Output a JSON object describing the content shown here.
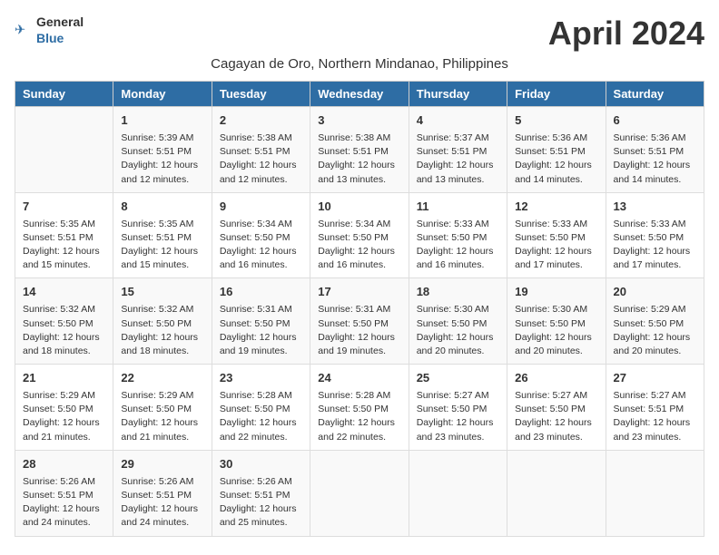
{
  "header": {
    "title": "April 2024",
    "subtitle": "Cagayan de Oro, Northern Mindanao, Philippines",
    "logo_general": "General",
    "logo_blue": "Blue"
  },
  "columns": [
    "Sunday",
    "Monday",
    "Tuesday",
    "Wednesday",
    "Thursday",
    "Friday",
    "Saturday"
  ],
  "weeks": [
    [
      {
        "day": "",
        "info": ""
      },
      {
        "day": "1",
        "info": "Sunrise: 5:39 AM\nSunset: 5:51 PM\nDaylight: 12 hours\nand 12 minutes."
      },
      {
        "day": "2",
        "info": "Sunrise: 5:38 AM\nSunset: 5:51 PM\nDaylight: 12 hours\nand 12 minutes."
      },
      {
        "day": "3",
        "info": "Sunrise: 5:38 AM\nSunset: 5:51 PM\nDaylight: 12 hours\nand 13 minutes."
      },
      {
        "day": "4",
        "info": "Sunrise: 5:37 AM\nSunset: 5:51 PM\nDaylight: 12 hours\nand 13 minutes."
      },
      {
        "day": "5",
        "info": "Sunrise: 5:36 AM\nSunset: 5:51 PM\nDaylight: 12 hours\nand 14 minutes."
      },
      {
        "day": "6",
        "info": "Sunrise: 5:36 AM\nSunset: 5:51 PM\nDaylight: 12 hours\nand 14 minutes."
      }
    ],
    [
      {
        "day": "7",
        "info": "Sunrise: 5:35 AM\nSunset: 5:51 PM\nDaylight: 12 hours\nand 15 minutes."
      },
      {
        "day": "8",
        "info": "Sunrise: 5:35 AM\nSunset: 5:51 PM\nDaylight: 12 hours\nand 15 minutes."
      },
      {
        "day": "9",
        "info": "Sunrise: 5:34 AM\nSunset: 5:50 PM\nDaylight: 12 hours\nand 16 minutes."
      },
      {
        "day": "10",
        "info": "Sunrise: 5:34 AM\nSunset: 5:50 PM\nDaylight: 12 hours\nand 16 minutes."
      },
      {
        "day": "11",
        "info": "Sunrise: 5:33 AM\nSunset: 5:50 PM\nDaylight: 12 hours\nand 16 minutes."
      },
      {
        "day": "12",
        "info": "Sunrise: 5:33 AM\nSunset: 5:50 PM\nDaylight: 12 hours\nand 17 minutes."
      },
      {
        "day": "13",
        "info": "Sunrise: 5:33 AM\nSunset: 5:50 PM\nDaylight: 12 hours\nand 17 minutes."
      }
    ],
    [
      {
        "day": "14",
        "info": "Sunrise: 5:32 AM\nSunset: 5:50 PM\nDaylight: 12 hours\nand 18 minutes."
      },
      {
        "day": "15",
        "info": "Sunrise: 5:32 AM\nSunset: 5:50 PM\nDaylight: 12 hours\nand 18 minutes."
      },
      {
        "day": "16",
        "info": "Sunrise: 5:31 AM\nSunset: 5:50 PM\nDaylight: 12 hours\nand 19 minutes."
      },
      {
        "day": "17",
        "info": "Sunrise: 5:31 AM\nSunset: 5:50 PM\nDaylight: 12 hours\nand 19 minutes."
      },
      {
        "day": "18",
        "info": "Sunrise: 5:30 AM\nSunset: 5:50 PM\nDaylight: 12 hours\nand 20 minutes."
      },
      {
        "day": "19",
        "info": "Sunrise: 5:30 AM\nSunset: 5:50 PM\nDaylight: 12 hours\nand 20 minutes."
      },
      {
        "day": "20",
        "info": "Sunrise: 5:29 AM\nSunset: 5:50 PM\nDaylight: 12 hours\nand 20 minutes."
      }
    ],
    [
      {
        "day": "21",
        "info": "Sunrise: 5:29 AM\nSunset: 5:50 PM\nDaylight: 12 hours\nand 21 minutes."
      },
      {
        "day": "22",
        "info": "Sunrise: 5:29 AM\nSunset: 5:50 PM\nDaylight: 12 hours\nand 21 minutes."
      },
      {
        "day": "23",
        "info": "Sunrise: 5:28 AM\nSunset: 5:50 PM\nDaylight: 12 hours\nand 22 minutes."
      },
      {
        "day": "24",
        "info": "Sunrise: 5:28 AM\nSunset: 5:50 PM\nDaylight: 12 hours\nand 22 minutes."
      },
      {
        "day": "25",
        "info": "Sunrise: 5:27 AM\nSunset: 5:50 PM\nDaylight: 12 hours\nand 23 minutes."
      },
      {
        "day": "26",
        "info": "Sunrise: 5:27 AM\nSunset: 5:50 PM\nDaylight: 12 hours\nand 23 minutes."
      },
      {
        "day": "27",
        "info": "Sunrise: 5:27 AM\nSunset: 5:51 PM\nDaylight: 12 hours\nand 23 minutes."
      }
    ],
    [
      {
        "day": "28",
        "info": "Sunrise: 5:26 AM\nSunset: 5:51 PM\nDaylight: 12 hours\nand 24 minutes."
      },
      {
        "day": "29",
        "info": "Sunrise: 5:26 AM\nSunset: 5:51 PM\nDaylight: 12 hours\nand 24 minutes."
      },
      {
        "day": "30",
        "info": "Sunrise: 5:26 AM\nSunset: 5:51 PM\nDaylight: 12 hours\nand 25 minutes."
      },
      {
        "day": "",
        "info": ""
      },
      {
        "day": "",
        "info": ""
      },
      {
        "day": "",
        "info": ""
      },
      {
        "day": "",
        "info": ""
      }
    ]
  ]
}
